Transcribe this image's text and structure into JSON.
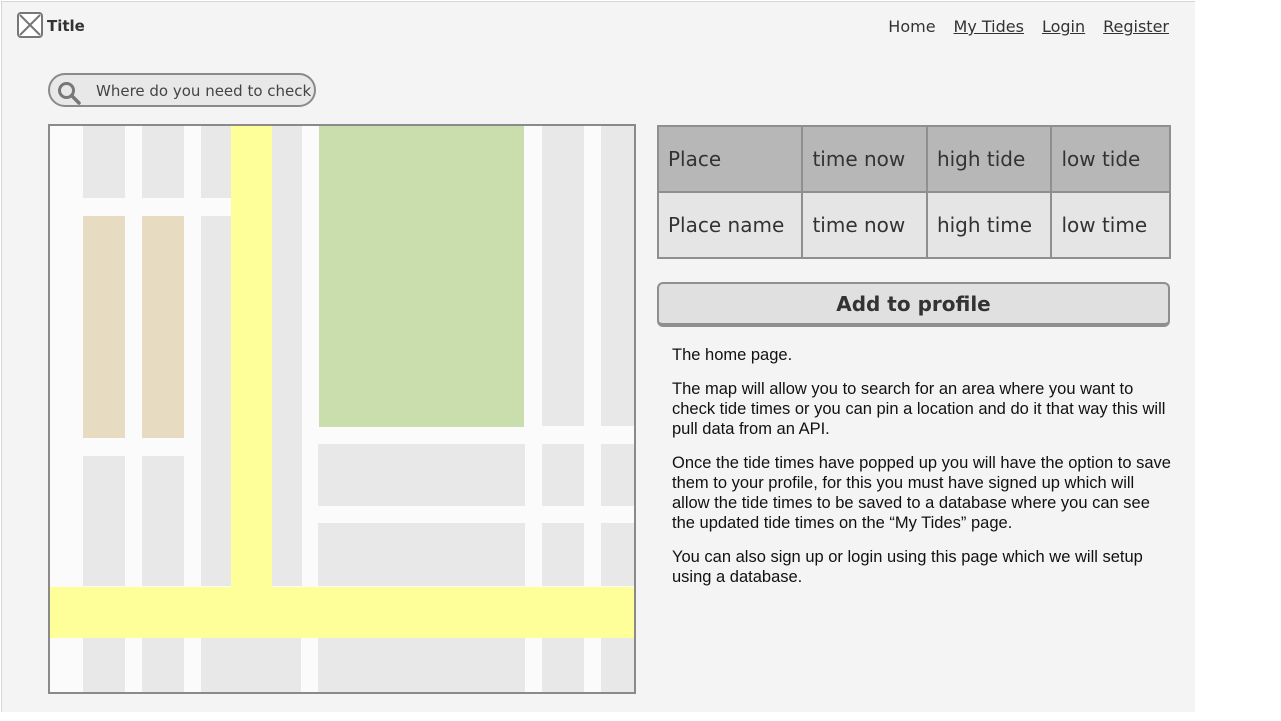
{
  "header": {
    "logo_icon": "image-placeholder-icon",
    "title": "Title",
    "nav": [
      {
        "label": "Home",
        "underlined": false
      },
      {
        "label": "My Tides",
        "underlined": true
      },
      {
        "label": "Login",
        "underlined": true
      },
      {
        "label": "Register",
        "underlined": true
      }
    ]
  },
  "search": {
    "icon": "search-icon",
    "placeholder": "Where do you need to check"
  },
  "map": {
    "colors": {
      "road_major": "#ffff99",
      "park": "#c9deac",
      "building": "#e8e8e8",
      "building_tan": "#e7dcc2",
      "background": "#fbfbfb"
    }
  },
  "table": {
    "headers": [
      "Place",
      "time now",
      "high tide",
      "low tide"
    ],
    "row": [
      "Place name",
      "time now",
      "high time",
      "low time"
    ]
  },
  "add_button": {
    "label": "Add to profile"
  },
  "description": {
    "paragraphs": [
      "The home page.",
      "The map will allow you to search for an area where you want to check tide times or you can pin a location and do it that way this will pull data from an API.",
      "Once the tide times have popped up you will have the option to save them to your profile, for this you must have signed up which will allow the tide times to be saved to a database where you can see the updated tide times on the “My Tides” page.",
      "You can also sign up or login using this page which we will setup using a database."
    ]
  }
}
